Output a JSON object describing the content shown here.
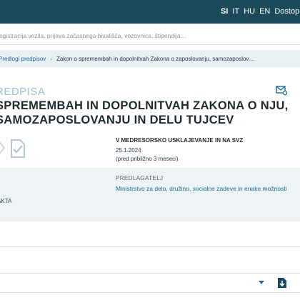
{
  "header": {
    "languages": [
      {
        "code": "SI",
        "active": true
      },
      {
        "code": "IT",
        "active": false
      },
      {
        "code": "HU",
        "active": false
      },
      {
        "code": "EN",
        "active": false
      }
    ],
    "accessibility_label": "Dostop"
  },
  "search": {
    "placeholder": "registracija vozila, prijava začasnega bivališča, vozovnica, štipendija…"
  },
  "breadcrumb": {
    "items": [
      "Predlogi predpisov",
      "Zakon o spremembah in dopolnitvah Zakona o zaposlovanju, samozaposlov…"
    ],
    "separator": "›"
  },
  "main": {
    "label_top": "REDPISA",
    "title": "SPREMEMBAH IN DOPOLNITVAH ZAKONA O NJU, SAMOZAPOSLOVANJU IN DELU TUJCEV",
    "phase": {
      "title": "V MEDRESORSKO USKLAJEVANJE IN NA SVZ",
      "date": "25.1.2024",
      "ago": "(pred približno 3 meseci)"
    },
    "info": {
      "predlagatelj_label": "PREDLAGATELJ",
      "predlagatelj_value": "Ministrstvo za delo, družino, socialne zadeve in enake možnosti",
      "akta_label": "AKTA"
    }
  },
  "colors": {
    "topbar": "#1c4a5a",
    "accent": "#1d6b8f",
    "label_light": "#9fc3d4"
  },
  "icons": [
    "mail-icon",
    "document-check-icon",
    "caret-down-icon",
    "download-icon"
  ]
}
